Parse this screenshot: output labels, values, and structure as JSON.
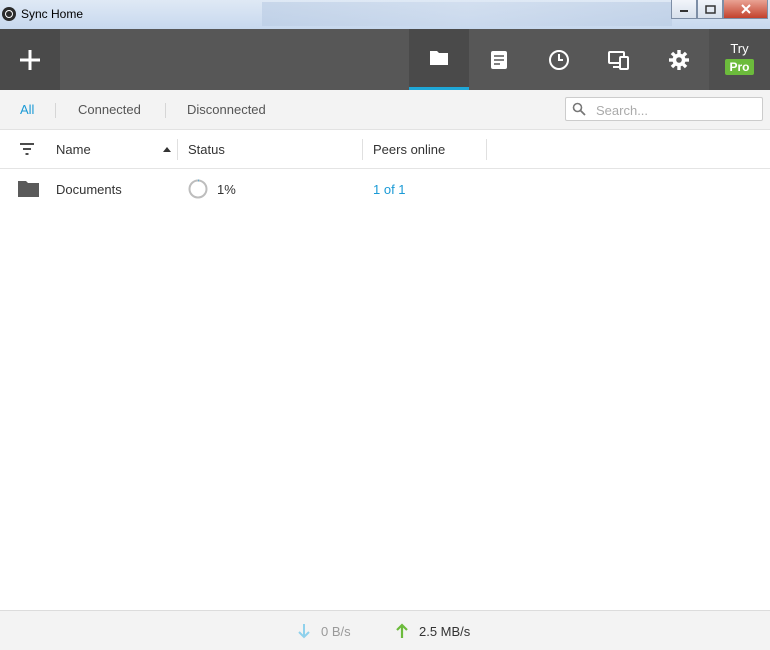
{
  "window": {
    "title": "Sync Home",
    "buttons": [
      "minimize",
      "maximize",
      "close"
    ]
  },
  "toolbar": {
    "add_icon": "plus-icon",
    "tools": [
      {
        "name": "folders",
        "icon": "folder-icon",
        "active": true
      },
      {
        "name": "history",
        "icon": "document-icon",
        "active": false
      },
      {
        "name": "transfers",
        "icon": "clock-icon",
        "active": false
      },
      {
        "name": "devices",
        "icon": "devices-icon",
        "active": false
      },
      {
        "name": "preferences",
        "icon": "gear-icon",
        "active": false
      }
    ],
    "try_label": "Try",
    "pro_label": "Pro"
  },
  "filters": {
    "tabs": [
      "All",
      "Connected",
      "Disconnected"
    ],
    "active_tab": "All",
    "search_placeholder": "Search..."
  },
  "table": {
    "columns": [
      "Name",
      "Status",
      "Peers online"
    ],
    "sort_column": "Name",
    "sort_direction": "ascending",
    "rows": [
      {
        "name": "Documents",
        "status": "1%",
        "status_progress": 0.01,
        "peers": "1 of 1"
      }
    ]
  },
  "statusbar": {
    "download_rate": "0 B/s",
    "upload_rate": "2.5 MB/s"
  },
  "colors": {
    "accent": "#1a9ad6",
    "toolbar_bg": "#575757",
    "pro_badge": "#6cbb3c",
    "upload_arrow": "#6cbb3c",
    "download_arrow": "#8fd1ec"
  }
}
